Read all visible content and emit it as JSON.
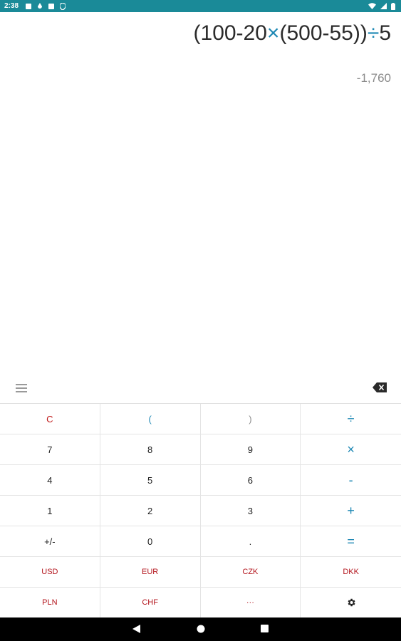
{
  "status_bar": {
    "time": "2:38"
  },
  "display": {
    "expression_parts": [
      {
        "text": "(100-20",
        "type": "num"
      },
      {
        "text": "×",
        "type": "op"
      },
      {
        "text": "(500-55))",
        "type": "num"
      },
      {
        "text": "÷",
        "type": "op"
      },
      {
        "text": "5",
        "type": "num"
      }
    ],
    "result": "-1,760"
  },
  "keypad": {
    "rows": [
      [
        "C",
        "(",
        ")",
        "÷"
      ],
      [
        "7",
        "8",
        "9",
        "×"
      ],
      [
        "4",
        "5",
        "6",
        "-"
      ],
      [
        "1",
        "2",
        "3",
        "+"
      ],
      [
        "+/-",
        "0",
        ".",
        "="
      ],
      [
        "USD",
        "EUR",
        "CZK",
        "DKK"
      ],
      [
        "PLN",
        "CHF",
        "···",
        "gear-icon"
      ]
    ]
  },
  "colors": {
    "status_bar": "#1a8a98",
    "operator": "#1e88b4",
    "currency": "#b3141c",
    "clear": "#c01818",
    "result": "#8a8a8a"
  }
}
